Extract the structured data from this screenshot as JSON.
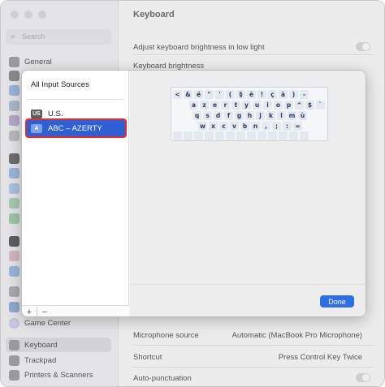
{
  "window": {
    "title": "Keyboard"
  },
  "sidebar": {
    "search_placeholder": "Search",
    "items": [
      {
        "label": "General",
        "icon": "gear-icon",
        "color": "#8e8e93"
      },
      {
        "label": "Game Center",
        "icon": "game-center-icon",
        "color": "#7a7a7a"
      },
      {
        "label": "Keyboard",
        "icon": "keyboard-icon",
        "color": "#8e8e93"
      },
      {
        "label": "Trackpad",
        "icon": "trackpad-icon",
        "color": "#8e8e93"
      },
      {
        "label": "Printers & Scanners",
        "icon": "printer-icon",
        "color": "#8e8e93"
      }
    ]
  },
  "main": {
    "rows": [
      {
        "label": "Adjust keyboard brightness in low light"
      },
      {
        "label": "Keyboard brightness"
      },
      {
        "label": "Microphone source",
        "value": "Automatic (MacBook Pro Microphone)"
      },
      {
        "label": "Shortcut",
        "value": "Press Control Key Twice"
      },
      {
        "label": "Auto-punctuation"
      }
    ]
  },
  "sheet": {
    "header": "All Input Sources",
    "sources": [
      {
        "badge": "US",
        "label": "U.S."
      },
      {
        "badge": "A",
        "label": "ABC – AZERTY"
      }
    ],
    "footer": {
      "add": "+",
      "remove": "−"
    },
    "keyboard": {
      "row1": [
        "<",
        "&",
        "é",
        "\"",
        "'",
        "(",
        "§",
        "è",
        "!",
        "ç",
        "à",
        ")",
        "-"
      ],
      "row2": [
        "a",
        "z",
        "e",
        "r",
        "t",
        "y",
        "u",
        "i",
        "o",
        "p",
        "^",
        "$",
        "`"
      ],
      "row3": [
        "q",
        "s",
        "d",
        "f",
        "g",
        "h",
        "j",
        "k",
        "l",
        "m",
        "ù"
      ],
      "row4": [
        "w",
        "x",
        "c",
        "v",
        "b",
        "n",
        ",",
        ";",
        ":",
        "="
      ]
    },
    "done_label": "Done"
  }
}
